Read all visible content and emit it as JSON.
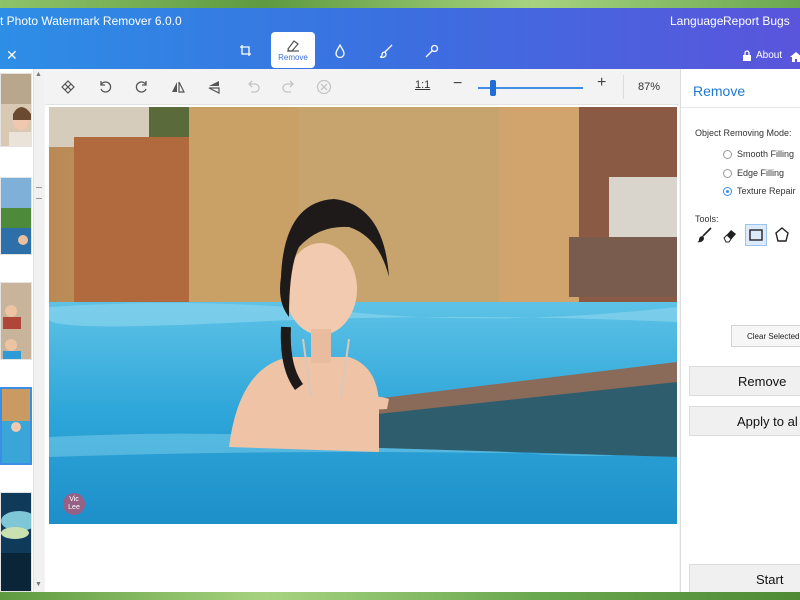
{
  "header": {
    "title": "t Photo Watermark Remover 6.0.0",
    "language": "Language",
    "report_bugs": "Report Bugs",
    "about": "About"
  },
  "main_tabs": [
    {
      "icon": "crop-icon",
      "label": ""
    },
    {
      "icon": "eraser-icon",
      "label": "Remove",
      "active": true
    },
    {
      "icon": "drop-icon",
      "label": ""
    },
    {
      "icon": "brush-icon",
      "label": ""
    },
    {
      "icon": "wand-icon",
      "label": ""
    }
  ],
  "toolbar": {
    "ratio": "1:1",
    "zoom": "87%",
    "zoom_level": 0.14
  },
  "canvas": {
    "watermark_text": "Vic Lee"
  },
  "panel": {
    "title": "Remove",
    "mode_label": "Object Removing Mode:",
    "modes": [
      {
        "label": "Smooth Filling",
        "checked": false
      },
      {
        "label": "Edge Filling",
        "checked": false
      },
      {
        "label": "Texture Repair",
        "checked": true
      }
    ],
    "tools_label": "Tools:",
    "tools": [
      "brush-icon",
      "eraser-icon",
      "rectangle-select-icon",
      "polygon-select-icon"
    ],
    "clear_selected": "Clear Selected",
    "remove_button": "Remove",
    "apply_button": "Apply to al",
    "start_button": "Start"
  },
  "colors": {
    "accent": "#3b8ee6",
    "header_start": "#2d8ee6",
    "header_end": "#5a55dc",
    "title_blue": "#1f78d1"
  }
}
